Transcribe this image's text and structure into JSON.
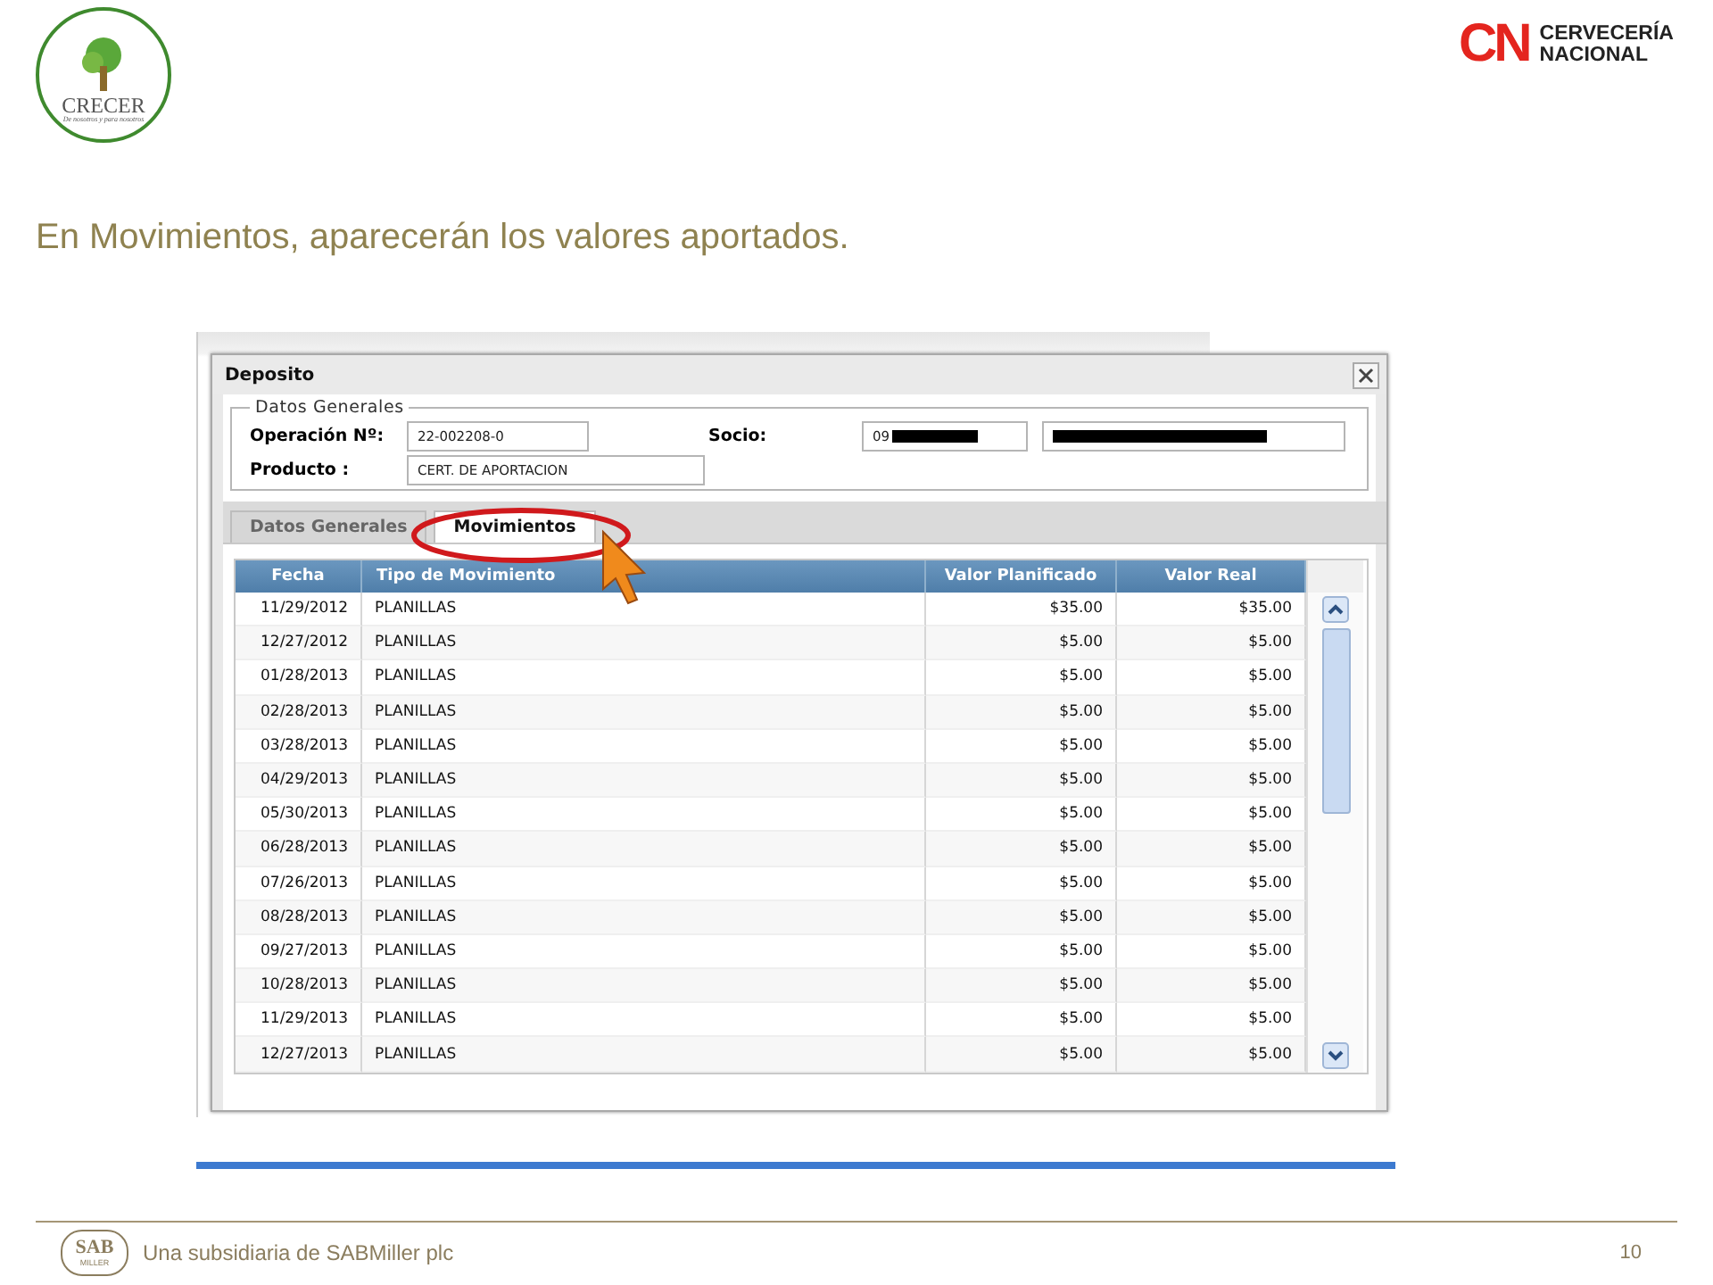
{
  "logos": {
    "crecer": {
      "name": "CRECER",
      "tagline": "De nosotros y para nosotros"
    },
    "brand": {
      "mark": "CN",
      "line1": "CERVECERÍA",
      "line2": "NACIONAL"
    }
  },
  "heading": "En Movimientos, aparecerán los valores aportados.",
  "dialog": {
    "title": "Deposito",
    "fieldset": {
      "legend": "Datos Generales",
      "fields": [
        {
          "label": "Operación Nº:",
          "value": "22-002208-0"
        },
        {
          "label": "Producto :",
          "value": "CERT. DE APORTACION"
        }
      ],
      "socio": {
        "label": "Socio:",
        "value": "09",
        "redacted": true
      }
    },
    "tabs": [
      {
        "label": "Datos Generales",
        "selected": false
      },
      {
        "label": "Movimientos",
        "selected": true
      }
    ],
    "table": {
      "columns": [
        "Fecha",
        "Tipo de Movimiento",
        "Valor Planificado",
        "Valor Real"
      ],
      "rows": [
        [
          "11/29/2012",
          "PLANILLAS",
          "$35.00",
          "$35.00"
        ],
        [
          "12/27/2012",
          "PLANILLAS",
          "$5.00",
          "$5.00"
        ],
        [
          "01/28/2013",
          "PLANILLAS",
          "$5.00",
          "$5.00"
        ],
        [
          "02/28/2013",
          "PLANILLAS",
          "$5.00",
          "$5.00"
        ],
        [
          "03/28/2013",
          "PLANILLAS",
          "$5.00",
          "$5.00"
        ],
        [
          "04/29/2013",
          "PLANILLAS",
          "$5.00",
          "$5.00"
        ],
        [
          "05/30/2013",
          "PLANILLAS",
          "$5.00",
          "$5.00"
        ],
        [
          "06/28/2013",
          "PLANILLAS",
          "$5.00",
          "$5.00"
        ],
        [
          "07/26/2013",
          "PLANILLAS",
          "$5.00",
          "$5.00"
        ],
        [
          "08/28/2013",
          "PLANILLAS",
          "$5.00",
          "$5.00"
        ],
        [
          "09/27/2013",
          "PLANILLAS",
          "$5.00",
          "$5.00"
        ],
        [
          "10/28/2013",
          "PLANILLAS",
          "$5.00",
          "$5.00"
        ],
        [
          "11/29/2013",
          "PLANILLAS",
          "$5.00",
          "$5.00"
        ],
        [
          "12/27/2013",
          "PLANILLAS",
          "$5.00",
          "$5.00"
        ]
      ]
    }
  },
  "footer": {
    "logo_top": "SAB",
    "logo_bottom": "MILLER",
    "text": "Una subsidiaria de SABMiller plc",
    "page": "10"
  }
}
